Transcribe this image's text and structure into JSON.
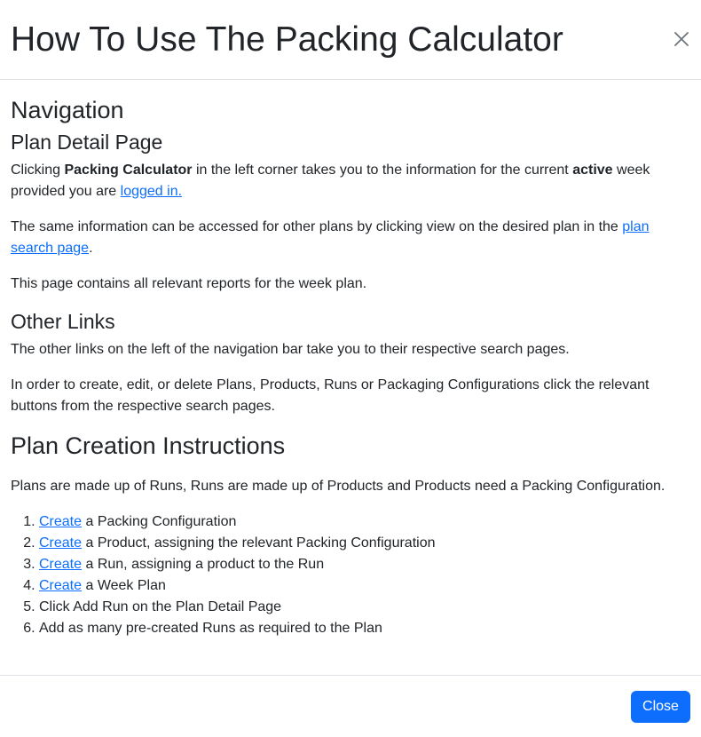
{
  "header": {
    "title": "How To Use The Packing Calculator",
    "close_icon": "close-icon"
  },
  "navigation": {
    "heading": "Navigation",
    "plan_detail": {
      "heading": "Plan Detail Page",
      "p1_before": "Clicking ",
      "p1_bold1": "Packing Calculator",
      "p1_middle": " in the left corner takes you to the information for the current ",
      "p1_bold2": "active",
      "p1_after": " week provided you are ",
      "p1_link": "logged in.",
      "p2_before": "The same information can be accessed for other plans by clicking view on the desired plan in the ",
      "p2_link": "plan search page",
      "p2_after": ".",
      "p3": "This page contains all relevant reports for the week plan."
    },
    "other_links": {
      "heading": "Other Links",
      "p1": "The other links on the left of the navigation bar take you to their respective search pages.",
      "p2": "In order to create, edit, or delete Plans, Products, Runs or Packaging Configurations click the relevant buttons from the respective search pages."
    }
  },
  "plan_creation": {
    "heading": "Plan Creation Instructions",
    "intro": "Plans are made up of Runs, Runs are made up of Products and Products need a Packing Configuration.",
    "steps": [
      {
        "link": "Create",
        "text": " a Packing Configuration"
      },
      {
        "link": "Create",
        "text": " a Product, assigning the relevant Packing Configuration"
      },
      {
        "link": "Create",
        "text": " a Run, assigning a product to the Run"
      },
      {
        "link": "Create",
        "text": " a Week Plan"
      },
      {
        "link": "",
        "text": "Click Add Run on the Plan Detail Page"
      },
      {
        "link": "",
        "text": "Add as many pre-created Runs as required to the Plan"
      }
    ]
  },
  "footer": {
    "close_label": "Close"
  },
  "colors": {
    "primary": "#0d6efd",
    "text": "#212529",
    "border": "#dee2e6"
  }
}
